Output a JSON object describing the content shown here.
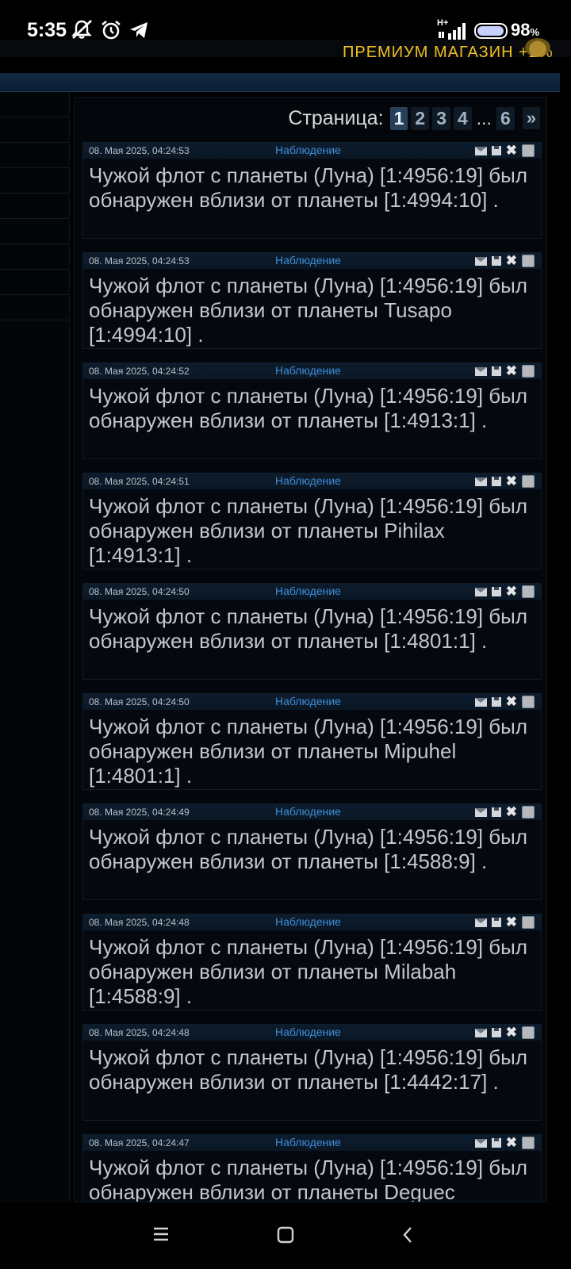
{
  "status_bar": {
    "time": "5:35",
    "network_label": "H+",
    "battery_percent": "98",
    "battery_unit": "%",
    "battery_level": 0.98,
    "icons": [
      "notifications-muted-icon",
      "alarm-icon",
      "telegram-icon",
      "signal-icon",
      "battery-icon"
    ]
  },
  "top_bar": {
    "premium_text": "ПРЕМИУМ МАГАЗИН +2%"
  },
  "pagination": {
    "label": "Страница:",
    "pages": [
      "1",
      "2",
      "3",
      "4",
      "6"
    ],
    "current": "1",
    "ellipsis": "...",
    "next": "»"
  },
  "messages": [
    {
      "date": "08. Мая 2025, 04:24:53",
      "type": "Наблюдение",
      "text": "Чужой флот с планеты (Луна) [1:4956:19] был обнаружен вблизи от планеты [1:4994:10] ."
    },
    {
      "date": "08. Мая 2025, 04:24:53",
      "type": "Наблюдение",
      "text": "Чужой флот с планеты (Луна) [1:4956:19] был обнаружен вблизи от планеты Tusapo [1:4994:10] ."
    },
    {
      "date": "08. Мая 2025, 04:24:52",
      "type": "Наблюдение",
      "text": "Чужой флот с планеты (Луна) [1:4956:19] был обнаружен вблизи от планеты [1:4913:1] ."
    },
    {
      "date": "08. Мая 2025, 04:24:51",
      "type": "Наблюдение",
      "text": "Чужой флот с планеты (Луна) [1:4956:19] был обнаружен вблизи от планеты Pihilax [1:4913:1] ."
    },
    {
      "date": "08. Мая 2025, 04:24:50",
      "type": "Наблюдение",
      "text": "Чужой флот с планеты (Луна) [1:4956:19] был обнаружен вблизи от планеты [1:4801:1] ."
    },
    {
      "date": "08. Мая 2025, 04:24:50",
      "type": "Наблюдение",
      "text": "Чужой флот с планеты (Луна) [1:4956:19] был обнаружен вблизи от планеты Mipuhel [1:4801:1] ."
    },
    {
      "date": "08. Мая 2025, 04:24:49",
      "type": "Наблюдение",
      "text": "Чужой флот с планеты (Луна) [1:4956:19] был обнаружен вблизи от планеты [1:4588:9] ."
    },
    {
      "date": "08. Мая 2025, 04:24:48",
      "type": "Наблюдение",
      "text": "Чужой флот с планеты (Луна) [1:4956:19] был обнаружен вблизи от планеты Milabah [1:4588:9] ."
    },
    {
      "date": "08. Мая 2025, 04:24:48",
      "type": "Наблюдение",
      "text": "Чужой флот с планеты (Луна) [1:4956:19] был обнаружен вблизи от планеты [1:4442:17] ."
    },
    {
      "date": "08. Мая 2025, 04:24:47",
      "type": "Наблюдение",
      "text": "Чужой флот с планеты (Луна) [1:4956:19] был обнаружен вблизи от планеты Deguec"
    }
  ],
  "colors": {
    "background": "#03070c",
    "header": "#0d1c2d",
    "accent_blue": "#3e8ed8",
    "text": "#c3c7cc",
    "premium_gold": "#f0c020"
  }
}
